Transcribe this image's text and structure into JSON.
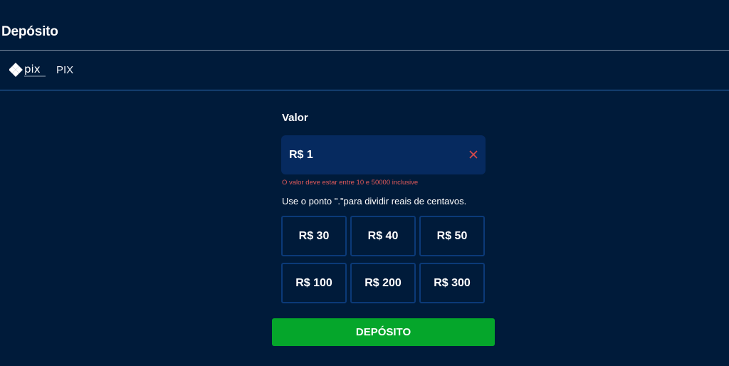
{
  "page": {
    "title": "Depósito"
  },
  "payment_method": {
    "label": "PIX",
    "logo_text": "pix",
    "icon": "pix-logo-icon"
  },
  "amount_field": {
    "label": "Valor",
    "value": "R$ 1",
    "clear_icon": "close-icon",
    "error": "O valor deve estar entre 10 e 50000 inclusive",
    "hint": "Use o ponto \".\"para dividir reais de centavos."
  },
  "presets": [
    {
      "label": "R$ 30"
    },
    {
      "label": "R$ 40"
    },
    {
      "label": "R$ 50"
    },
    {
      "label": "R$ 100"
    },
    {
      "label": "R$ 200"
    },
    {
      "label": "R$ 300"
    }
  ],
  "submit": {
    "label": "DEPÓSITO"
  },
  "colors": {
    "background": "#001b3a",
    "input_background": "#062a5f",
    "preset_border": "#0b3a78",
    "error": "#e05a5a",
    "submit_button": "#05a62b",
    "clear_icon": "#d94a4a"
  }
}
